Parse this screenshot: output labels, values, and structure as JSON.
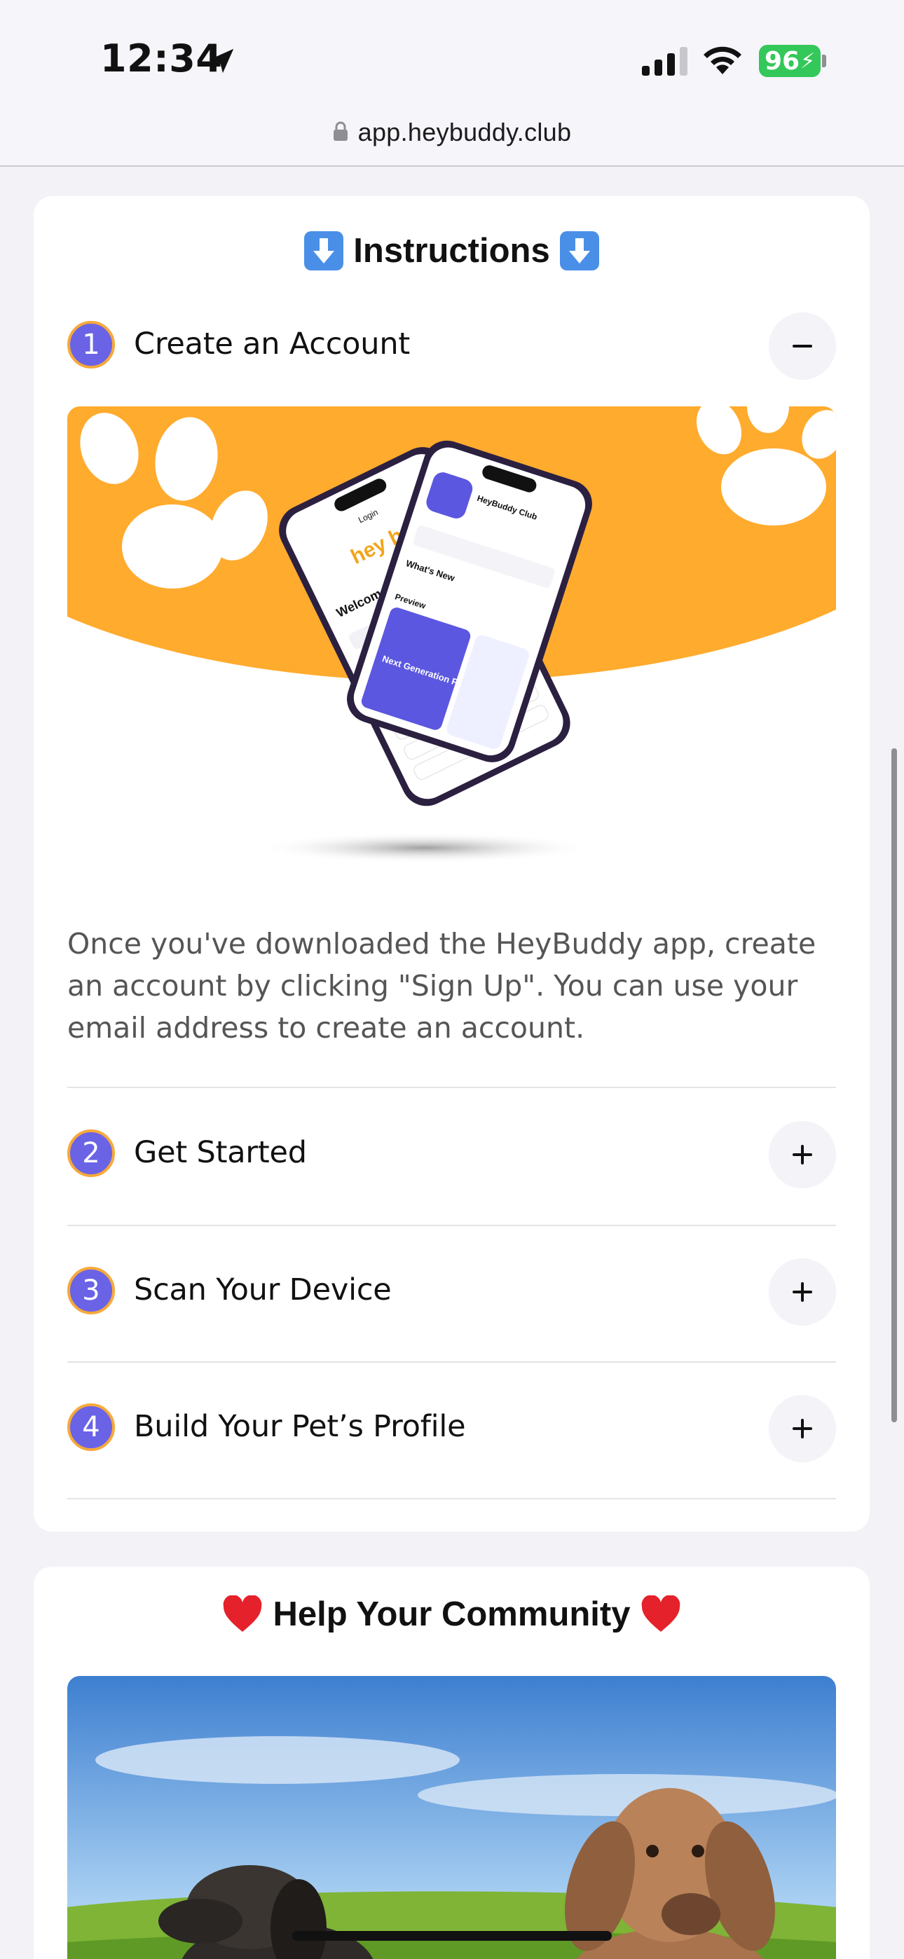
{
  "status_bar": {
    "time": "12:34",
    "battery": "96",
    "icons": [
      "location-arrow-icon",
      "cellular-signal-icon",
      "wifi-icon",
      "battery-icon"
    ]
  },
  "browser": {
    "url": "app.heybuddy.club",
    "lock_icon": "lock-icon"
  },
  "instructions": {
    "title": "Instructions",
    "title_icon": "down-arrow-emoji-icon",
    "items": [
      {
        "number": "1",
        "title": "Create an Account",
        "expanded": true,
        "description": "Once you've downloaded the HeyBuddy app, create an account by clicking \"Sign Up\". You can use your email address to create an account."
      },
      {
        "number": "2",
        "title": "Get Started",
        "expanded": false
      },
      {
        "number": "3",
        "title": "Scan Your Device",
        "expanded": false
      },
      {
        "number": "4",
        "title": "Build Your Pet’s Profile",
        "expanded": false
      }
    ],
    "hero_image": {
      "login_title": "Login",
      "welcome": "Welcome",
      "logo": "hey buddy",
      "store_name": "HeyBuddy Club",
      "whats_new": "What's New",
      "preview": "Preview",
      "promo": "Next Generation Pet ID"
    }
  },
  "community": {
    "title": "Help Your Community",
    "title_icon": "red-heart-emoji-icon"
  },
  "colors": {
    "badge_fill": "#6a63e6",
    "badge_ring": "#f6a93b",
    "hero_orange": "#ffab2e",
    "battery_green": "#34c759"
  }
}
